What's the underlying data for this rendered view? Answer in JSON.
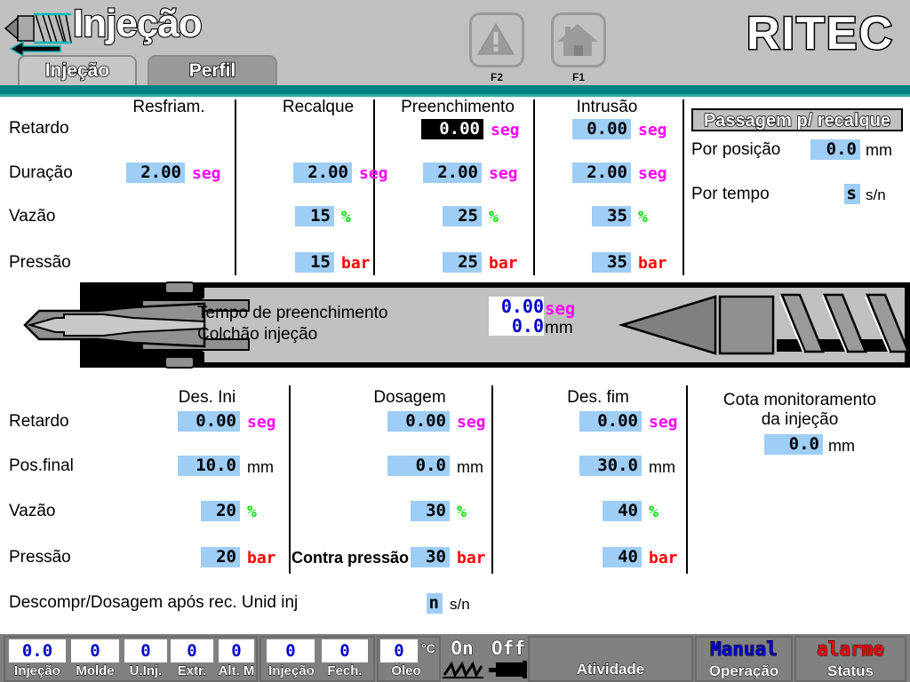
{
  "header": {
    "title": "Injeção",
    "logo": "RITEC",
    "fkeys": [
      {
        "label": "F2",
        "icon": "warning-triangle-icon"
      },
      {
        "label": "F1",
        "icon": "home-icon"
      }
    ],
    "tabs": [
      {
        "label": "Injeção",
        "active": true
      },
      {
        "label": "Perfil",
        "active": false
      }
    ]
  },
  "upper": {
    "row_labels": [
      "Retardo",
      "Duração",
      "Vazão",
      "Pressão"
    ],
    "columns": [
      {
        "name": "Resfriam.",
        "retardo": null,
        "retardo_unit": null,
        "duracao": "2.00",
        "duracao_unit": "seg",
        "vazao": null,
        "vazao_unit": null,
        "pressao": null,
        "pressao_unit": null
      },
      {
        "name": "Recalque",
        "retardo": null,
        "retardo_unit": null,
        "duracao": "2.00",
        "duracao_unit": "seg",
        "vazao": "15",
        "vazao_unit": "%",
        "pressao": "15",
        "pressao_unit": "bar"
      },
      {
        "name": "Preenchimento",
        "retardo": "0.00",
        "retardo_unit": "seg",
        "retardo_focused": true,
        "duracao": "2.00",
        "duracao_unit": "seg",
        "vazao": "25",
        "vazao_unit": "%",
        "pressao": "25",
        "pressao_unit": "bar"
      },
      {
        "name": "Intrusão",
        "retardo": "0.00",
        "retardo_unit": "seg",
        "duracao": "2.00",
        "duracao_unit": "seg",
        "vazao": "35",
        "vazao_unit": "%",
        "pressao": "35",
        "pressao_unit": "bar"
      }
    ]
  },
  "passagem": {
    "title": "Passagem p/ recalque",
    "pos_label": "Por posição",
    "pos_value": "0.0",
    "pos_unit": "mm",
    "time_label": "Por tempo",
    "time_value": "s",
    "time_unit": "s/n"
  },
  "machine": {
    "line1_label": "Tempo de preenchimento",
    "line2_label": "Colchão injeção",
    "line1_value": "0.00",
    "line1_unit": "seg",
    "line2_value": "0.0",
    "line2_unit": "mm"
  },
  "lower": {
    "row_labels": [
      "Retardo",
      "Pos.final",
      "Vazão",
      "Pressão"
    ],
    "contra_pressao_label": "Contra pressão",
    "columns": [
      {
        "name": "Des. Ini",
        "retardo": "0.00",
        "retardo_unit": "seg",
        "posfinal": "10.0",
        "posfinal_unit": "mm",
        "vazao": "20",
        "vazao_unit": "%",
        "pressao": "20",
        "pressao_unit": "bar"
      },
      {
        "name": "Dosagem",
        "retardo": "0.00",
        "retardo_unit": "seg",
        "posfinal": "0.0",
        "posfinal_unit": "mm",
        "vazao": "30",
        "vazao_unit": "%",
        "pressao": "30",
        "pressao_unit": "bar"
      },
      {
        "name": "Des. fim",
        "retardo": "0.00",
        "retardo_unit": "seg",
        "posfinal": "30.0",
        "posfinal_unit": "mm",
        "vazao": "40",
        "vazao_unit": "%",
        "pressao": "40",
        "pressao_unit": "bar"
      }
    ]
  },
  "cota": {
    "label_line1": "Cota monitoramento",
    "label_line2": "da injeção",
    "value": "0.0",
    "unit": "mm"
  },
  "descompr": {
    "label": "Descompr/Dosagem após rec. Unid inj",
    "value": "n",
    "unit": "s/n"
  },
  "status": {
    "group1": [
      {
        "value": "0.0",
        "label": "Injeção"
      },
      {
        "value": "0",
        "label": "Molde"
      },
      {
        "value": "0",
        "label": "U.Inj."
      },
      {
        "value": "0",
        "label": "Extr."
      },
      {
        "value": "0",
        "label": "Alt. M"
      }
    ],
    "group2": [
      {
        "value": "0",
        "label": "Injeção"
      },
      {
        "value": "0",
        "label": "Fech."
      }
    ],
    "group3": [
      {
        "value": "0",
        "label": "Óleo",
        "unit": "°C"
      }
    ],
    "heater": {
      "state": "On",
      "icon": "heater-coil-icon"
    },
    "motor": {
      "state": "Off",
      "icon": "motor-icon"
    },
    "activity_label": "Atividade",
    "operation_value": "Manual",
    "operation_label": "Operação",
    "alarm_value": "alarme",
    "alarm_label": "Status"
  },
  "colors": {
    "accent_teal": "#008080",
    "field_blue": "#9ecdf5",
    "unit_seg": "#ff00ff",
    "unit_pct": "#00dd00",
    "unit_bar": "#ff0000",
    "value_blue": "#0000cc",
    "alarm_red": "#ff0000",
    "chrome_gray": "#c0c0c0"
  }
}
